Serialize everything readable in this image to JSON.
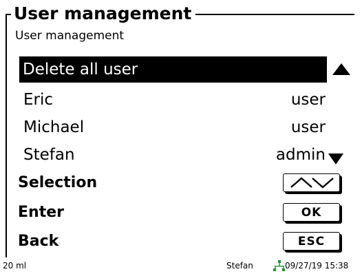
{
  "header": {
    "title": "User management",
    "subtitle": "User management"
  },
  "user_list": {
    "items": [
      {
        "name": "Delete all user",
        "role": "",
        "selected": true
      },
      {
        "name": "Eric",
        "role": "user",
        "selected": false
      },
      {
        "name": "Michael",
        "role": "user",
        "selected": false
      },
      {
        "name": "Stefan",
        "role": "admin",
        "selected": false
      }
    ],
    "scroll_up_icon": "triangle-up",
    "scroll_down_icon": "triangle-down"
  },
  "actions": {
    "selection_label": "Selection",
    "selection_key_icon": "up-down-arrows",
    "enter_label": "Enter",
    "enter_key": "OK",
    "back_label": "Back",
    "back_key": "ESC"
  },
  "status_bar": {
    "left_text": "20 ml",
    "user": "Stefan",
    "network_icon": "network-connected",
    "network_color": "#1a9a2a",
    "datetime": "09/27/19 15:38"
  }
}
